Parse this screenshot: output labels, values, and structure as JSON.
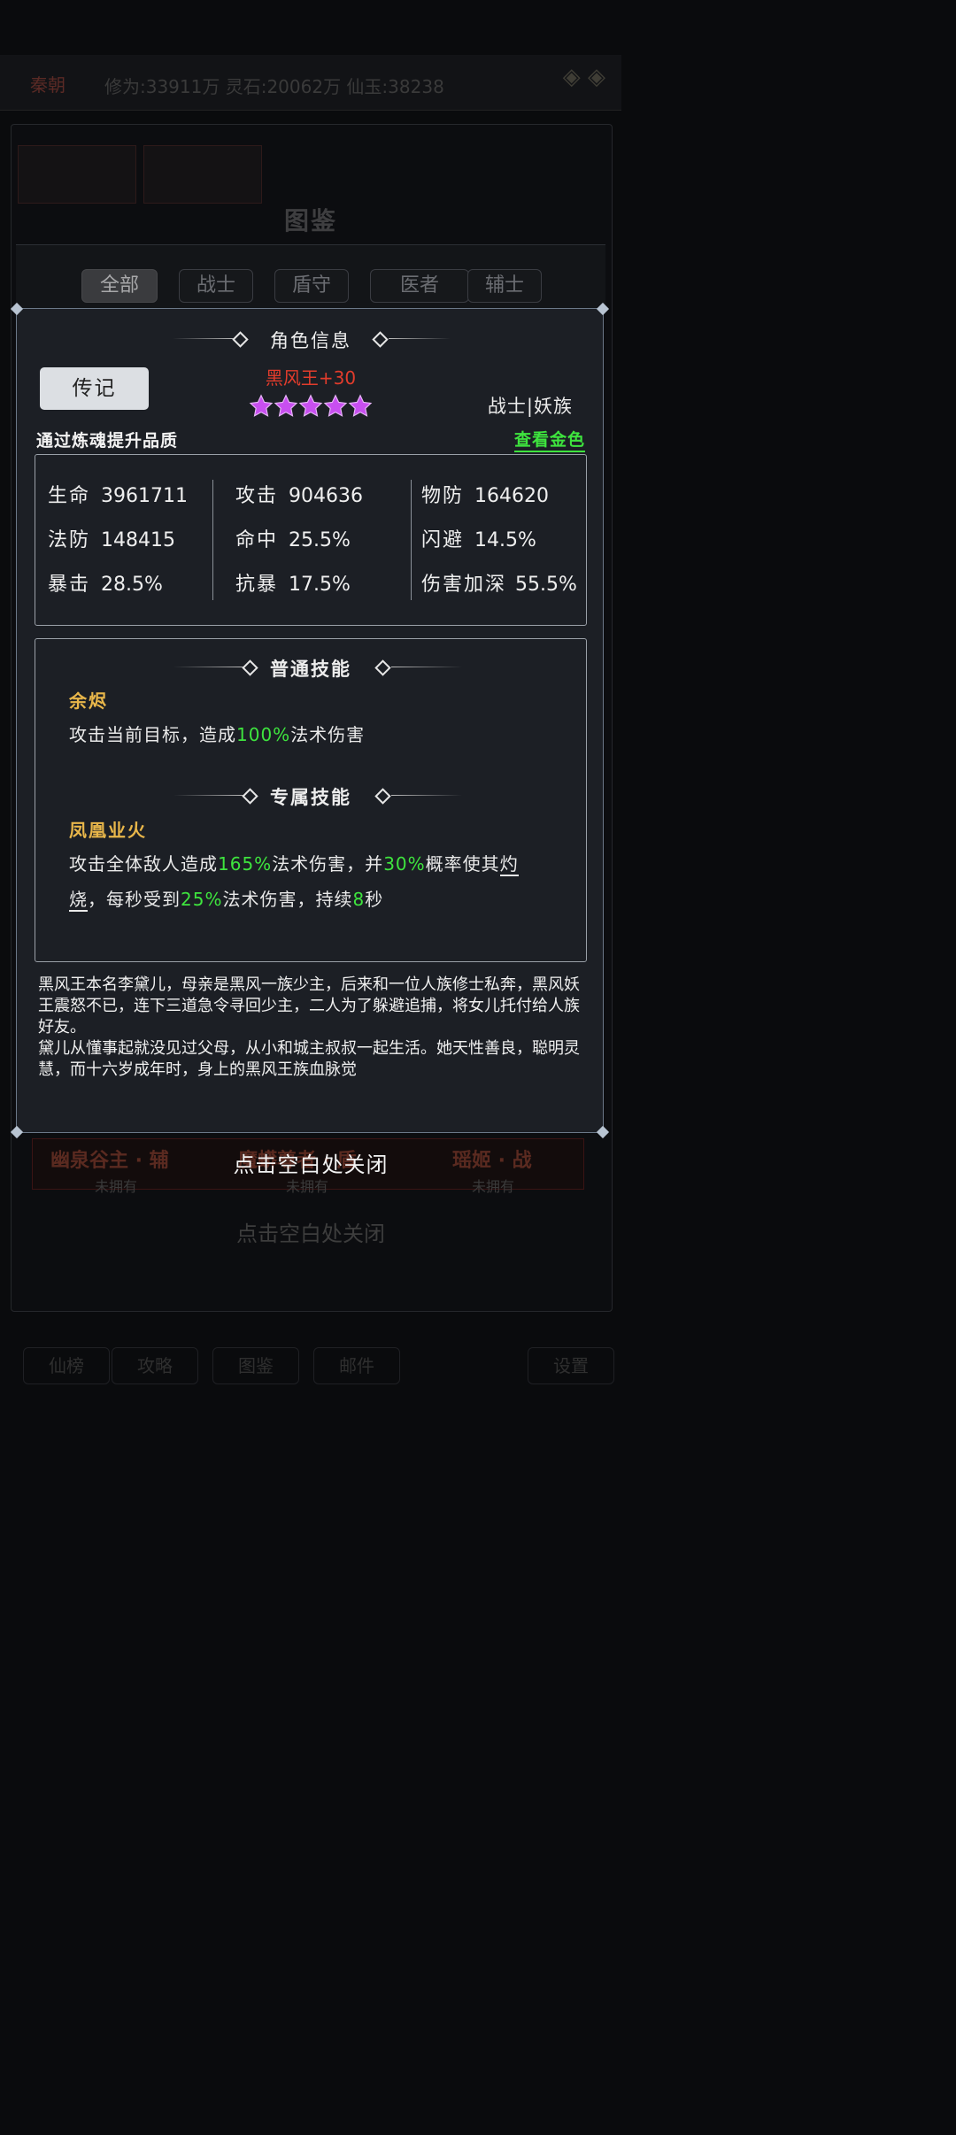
{
  "background": {
    "realm": "秦朝",
    "stats_text": "修为:33911万 灵石:20062万 仙玉:38238",
    "title": "图鉴",
    "heroes": [
      {
        "name": "幽泉谷主 · 辅",
        "status": "未拥有"
      },
      {
        "name": "魔蟒尊者 · 盾",
        "status": "未拥有"
      },
      {
        "name": "瑶姬 · 战",
        "status": "未拥有"
      }
    ],
    "close_hint": "点击空白处关闭",
    "nav": [
      "仙榜",
      "攻略",
      "图鉴",
      "邮件",
      "设置"
    ]
  },
  "tabs": [
    {
      "label": "全部",
      "active": true
    },
    {
      "label": "战士",
      "active": false
    },
    {
      "label": "盾守",
      "active": false
    },
    {
      "label": "医者",
      "active": false
    },
    {
      "label": "辅士",
      "active": false
    }
  ],
  "panel": {
    "section_title": "角色信息",
    "bio_button": "传记",
    "hero_name": "黑风王+30",
    "stars": 5,
    "star_color": "#c84ff0",
    "hero_tags": "战士|妖族",
    "upgrade_hint": "通过炼魂提升品质",
    "gold_link": "查看金色",
    "stats": {
      "hp": {
        "label": "生命",
        "value": "3961711"
      },
      "atk": {
        "label": "攻击",
        "value": "904636"
      },
      "pdef": {
        "label": "物防",
        "value": "164620"
      },
      "mdef": {
        "label": "法防",
        "value": "148415"
      },
      "hit": {
        "label": "命中",
        "value": "25.5%"
      },
      "dodge": {
        "label": "闪避",
        "value": "14.5%"
      },
      "crit": {
        "label": "暴击",
        "value": "28.5%"
      },
      "anticrit": {
        "label": "抗暴",
        "value": "17.5%"
      },
      "dmgup": {
        "label": "伤害加深",
        "value": "55.5%"
      }
    },
    "normal_skill": {
      "header": "普通技能",
      "name": "余烬",
      "desc": {
        "a": "攻击当前目标，造成",
        "b": "100%",
        "c": "法术伤害"
      }
    },
    "special_skill": {
      "header": "专属技能",
      "name": "凤凰业火",
      "desc": {
        "a": "攻击全体敌人造成",
        "b": "165%",
        "c": "法术伤害，并",
        "d": "30%",
        "e": "概率使其",
        "f": "灼",
        "g": "烧",
        "h": "，每秒受到",
        "i": "25%",
        "j": "法术伤害，持续",
        "k": "8",
        "l": "秒"
      }
    },
    "biography": [
      "黑风王本名李黛儿，母亲是黑风一族少主，后来和一位人族修士私奔，黑风妖王震怒不已，连下三道急令寻回少主，二人为了躲避追捕，将女儿托付给人族好友。",
      "黛儿从懂事起就没见过父母，从小和城主叔叔一起生活。她天性善良，聪明灵慧，而十六岁成年时，身上的黑风王族血脉觉"
    ]
  },
  "close_hint": "点击空白处关闭",
  "colors": {
    "panel_bg": "#1c1f25",
    "hero_name": "#e23c2c",
    "skill_name": "#e8b64a",
    "highlight_green": "#3ee43e"
  }
}
